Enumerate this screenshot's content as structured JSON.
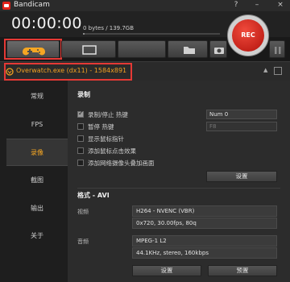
{
  "app": {
    "title": "Bandicam"
  },
  "window_controls": {
    "help": "?",
    "minimize": "–",
    "close": "×"
  },
  "header": {
    "timer": "00:00:00",
    "filesize": "0 bytes / 139.7GB",
    "disk_usage": 0.01
  },
  "toolbar": {
    "record_label": "REC"
  },
  "target": {
    "text": "Overwatch.exe (dx11) - 1584x891",
    "collapse_glyph": "▲"
  },
  "sidebar": {
    "items": [
      {
        "label": "常规"
      },
      {
        "label": "FPS"
      },
      {
        "label": "录像"
      },
      {
        "label": "截图"
      },
      {
        "label": "输出"
      },
      {
        "label": "关于"
      }
    ]
  },
  "record": {
    "title": "录制",
    "options": [
      {
        "label": "录制/停止 热键",
        "checked": true
      },
      {
        "label": "暂停 热键",
        "checked": false
      },
      {
        "label": "显示鼠标指针",
        "checked": false
      },
      {
        "label": "添加鼠标点击效果",
        "checked": false
      },
      {
        "label": "添加网络摄像头叠加画面",
        "checked": false
      }
    ],
    "hotkey_value": "Num 0",
    "pause_hotkey_value": "F8",
    "settings_button": "设置"
  },
  "format": {
    "title": "格式 - AVI",
    "video_label": "视频",
    "video_codec": "H264 - NVENC (VBR)",
    "video_detail": "0x720, 30.00fps, 80q",
    "audio_label": "音频",
    "audio_codec": "MPEG-1 L2",
    "audio_detail": "44.1KHz, stereo, 160kbps",
    "settings_button": "设置",
    "preset_button": "预置"
  },
  "colors": {
    "accent": "#f5a623",
    "rec": "#d0211a",
    "highlight": "#e53935"
  }
}
